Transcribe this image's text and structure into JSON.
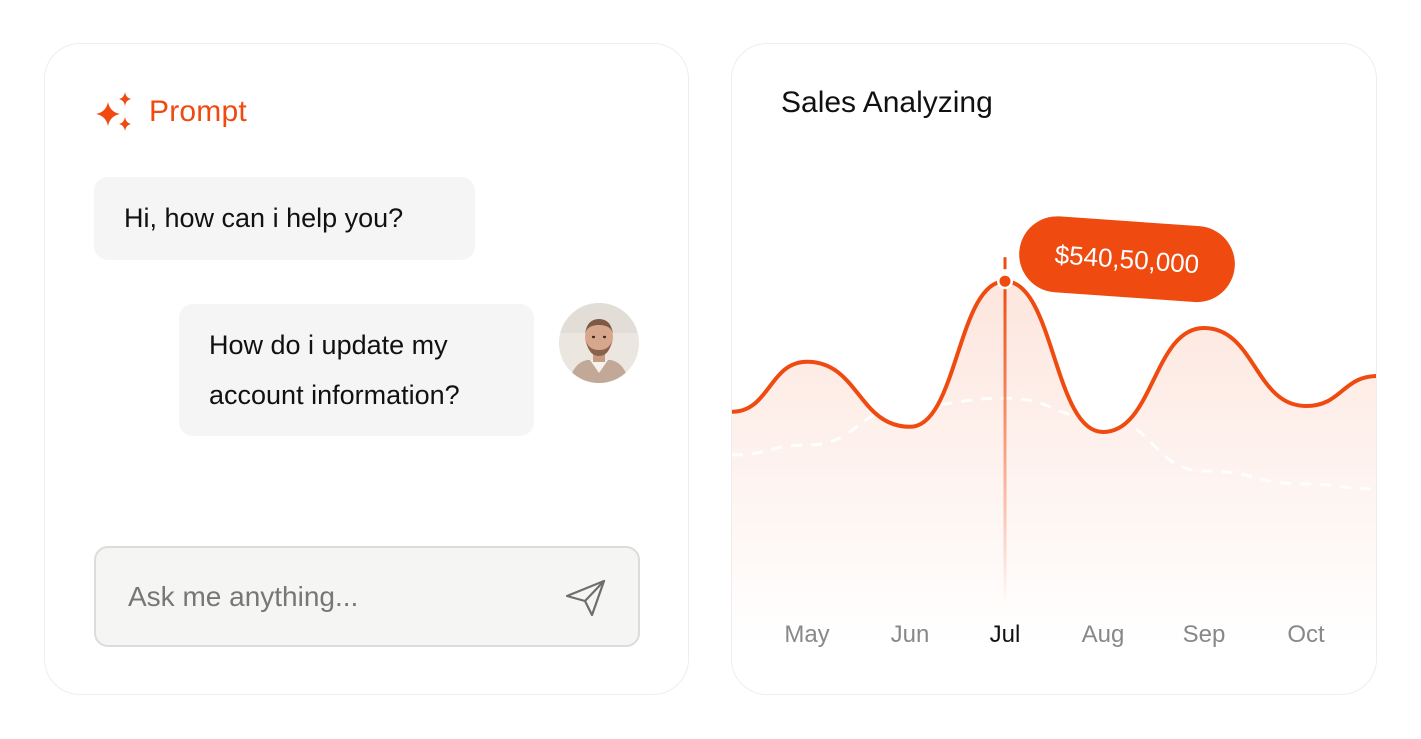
{
  "prompt_panel": {
    "title": "Prompt",
    "messages": [
      {
        "role": "assistant",
        "text": "Hi, how can i help you?"
      },
      {
        "role": "user",
        "line1": "How do i update my",
        "line2": "account information?"
      }
    ],
    "input": {
      "placeholder": "Ask me anything..."
    }
  },
  "chart_panel": {
    "title": "Sales Analyzing"
  },
  "chart_data": {
    "type": "line",
    "categories": [
      "May",
      "Jun",
      "Jul",
      "Aug",
      "Sep",
      "Oct"
    ],
    "highlighted": "Jul",
    "highlight_label": "$540,50,000",
    "series": [
      {
        "values": [
          0.47,
          0.22,
          0.78,
          0.2,
          0.6,
          0.3
        ]
      },
      {
        "values": [
          0.15,
          0.3,
          0.33,
          0.25,
          0.05,
          0.0
        ]
      }
    ],
    "grid": false
  },
  "colors": {
    "accent": "#ef4a10",
    "bubble_bg": "#f5f5f5",
    "text": "#111111",
    "muted": "#888888"
  },
  "icons": [
    "sparkle-icon",
    "send-icon"
  ]
}
